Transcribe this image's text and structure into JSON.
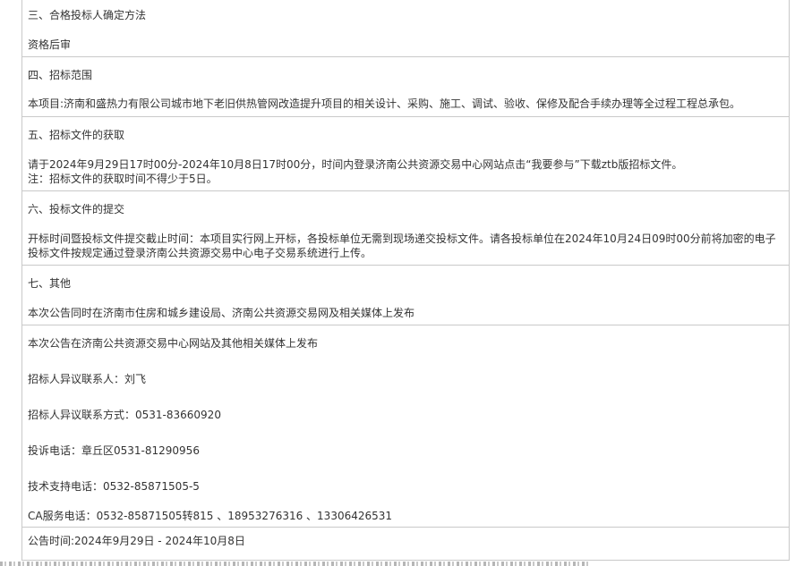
{
  "sections": {
    "s3": {
      "heading": "三、合格投标人确定方法",
      "body": "资格后审"
    },
    "s4": {
      "heading": "四、招标范围",
      "body": "本项目:济南和盛热力有限公司城市地下老旧供热管网改造提升项目的相关设计、采购、施工、调试、验收、保修及配合手续办理等全过程工程总承包。"
    },
    "s5": {
      "heading": "五、招标文件的获取",
      "line1": "请于2024年9月29日17时00分-2024年10月8日17时00分，时间内登录济南公共资源交易中心网站点击“我要参与”下载ztb版招标文件。",
      "line2": "注：招标文件的获取时间不得少于5日。"
    },
    "s6": {
      "heading": "六、投标文件的提交",
      "body": "开标时间暨投标文件提交截止时间：本项目实行网上开标，各投标单位无需到现场递交投标文件。请各投标单位在2024年10月24日09时00分前将加密的电子投标文件按规定通过登录济南公共资源交易中心电子交易系统进行上传。"
    },
    "s7": {
      "heading": "七、其他",
      "body": "本次公告同时在济南市住房和城乡建设局、济南公共资源交易网及相关媒体上发布"
    },
    "contact": {
      "publish_note": "本次公告在济南公共资源交易中心网站及其他相关媒体上发布",
      "objection_contact": "招标人异议联系人：刘飞",
      "objection_phone": "招标人异议联系方式：0531-83660920",
      "complaint_phone": "投诉电话：章丘区0531-81290956",
      "tech_support": "技术支持电话：0532-85871505-5",
      "ca_service": "CA服务电话：0532-85871505转815 、18953276316 、13306426531"
    },
    "notice_period": "公告时间:2024年9月29日 - 2024年10月8日"
  }
}
